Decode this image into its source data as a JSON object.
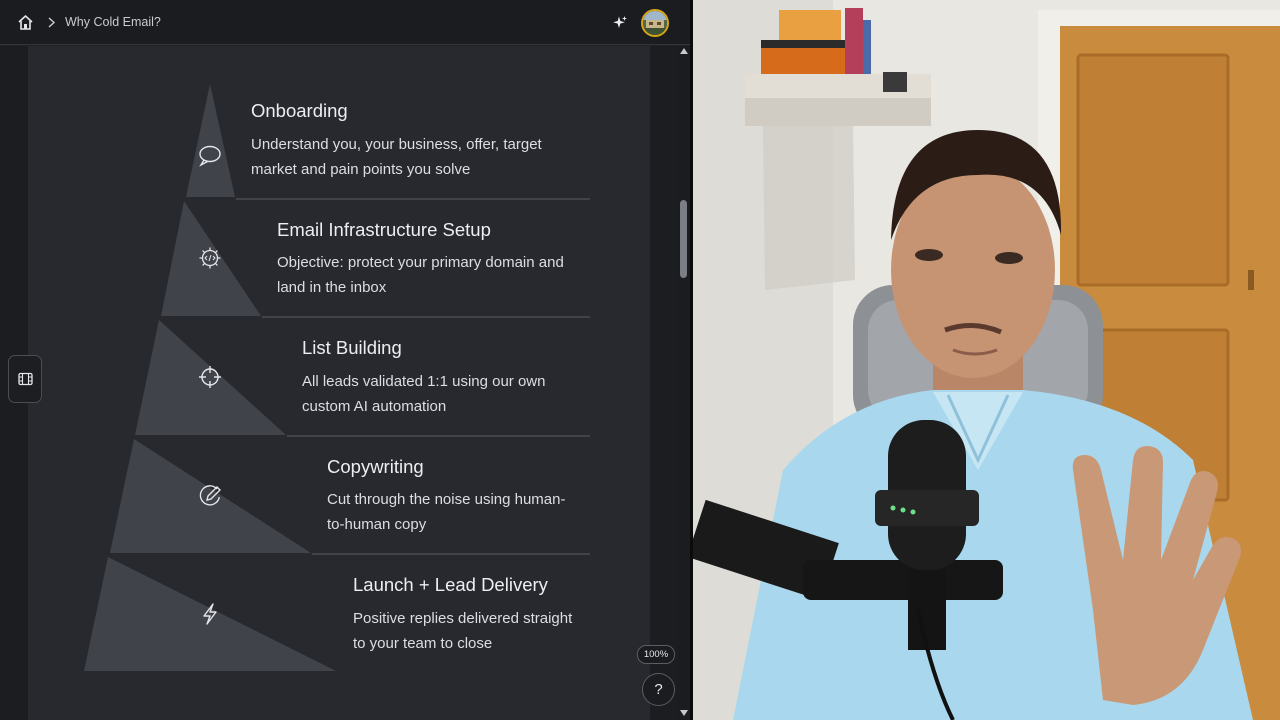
{
  "breadcrumb": {
    "current": "Why Cold Email?"
  },
  "pyramid": {
    "fill_color": "#40434a",
    "rows": [
      {
        "title": "Onboarding",
        "description": "Understand you, your business, offer, target market and pain points you solve",
        "icon": "chat-bubble-icon"
      },
      {
        "title": "Email Infrastructure Setup",
        "description": "Objective: protect your primary domain and land in the inbox",
        "icon": "code-gear-icon"
      },
      {
        "title": "List Building",
        "description": "All leads validated 1:1 using our own custom AI automation",
        "icon": "crosshair-icon"
      },
      {
        "title": "Copywriting",
        "description": "Cut through the noise using human-to-human copy",
        "icon": "edit-pen-icon"
      },
      {
        "title": "Launch + Lead Delivery",
        "description": "Positive replies delivered straight to your team to close",
        "icon": "lightning-icon"
      }
    ]
  },
  "controls": {
    "zoom": "100%",
    "help": "?"
  },
  "colors": {
    "panel": "#27292e",
    "accent_avatar_ring": "#d6a617"
  }
}
